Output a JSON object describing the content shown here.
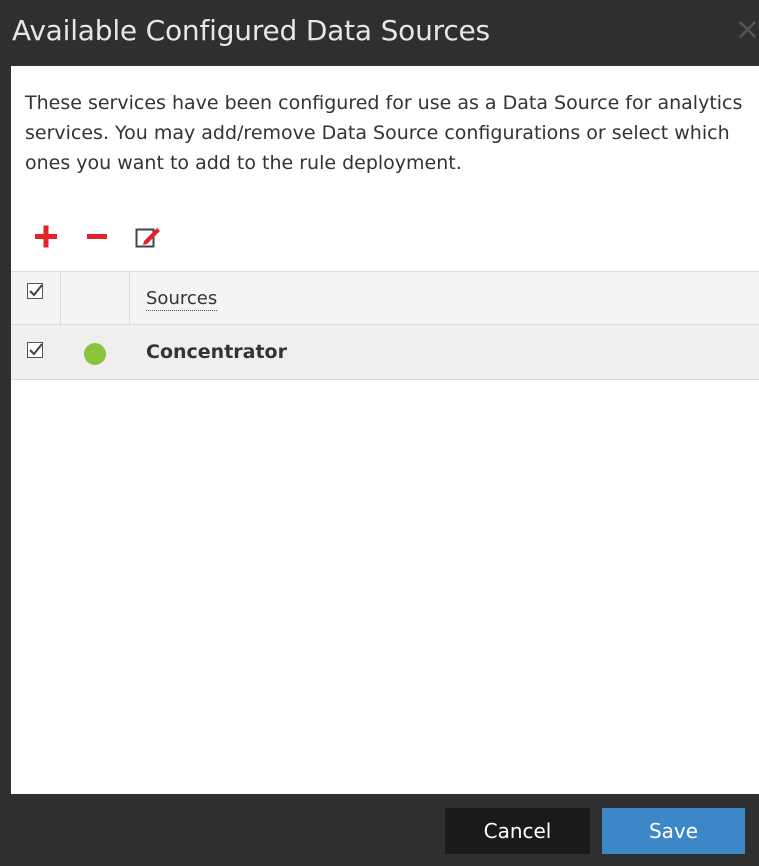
{
  "dialog": {
    "title": "Available Configured Data Sources",
    "close_label": "×",
    "description": "These services have been configured for use as a Data Source for analytics services. You may add/remove Data Source configurations or select which ones you want to add to the rule deployment."
  },
  "toolbar": {
    "add_icon": "plus-icon",
    "remove_icon": "minus-icon",
    "edit_icon": "edit-icon",
    "accent_color": "#e0242a"
  },
  "grid": {
    "columns": [
      "",
      "",
      "Sources"
    ],
    "header_checked": true,
    "rows": [
      {
        "checked": true,
        "status": "online",
        "status_color": "#8ac43f",
        "name": "Concentrator"
      }
    ]
  },
  "footer": {
    "cancel_label": "Cancel",
    "save_label": "Save",
    "save_color": "#3c87c8"
  }
}
